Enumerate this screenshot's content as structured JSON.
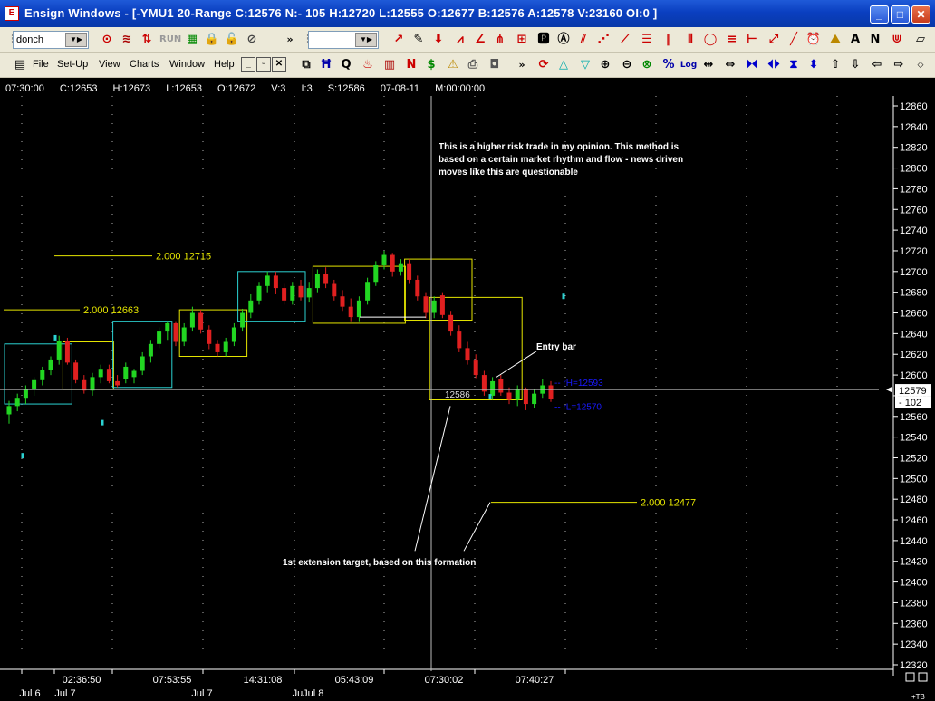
{
  "window": {
    "title": "Ensign Windows - [-YMU1 20-Range C:12576 N:- 105 H:12720 L:12555 O:12677 B:12576 A:12578 V:23160 OI:0 ]",
    "minimize": "_",
    "maximize": "□",
    "close": "✕"
  },
  "toolbar1": {
    "study_combo": "donch",
    "run_label": "RUN"
  },
  "menu": {
    "items": [
      "File",
      "Set-Up",
      "View",
      "Charts",
      "Window",
      "Help"
    ],
    "mdi_minimize": "_",
    "mdi_restore": "▫",
    "mdi_close": "✕"
  },
  "info": {
    "time": "07:30:00",
    "close": "C:12653",
    "high": "H:12673",
    "low": "L:12653",
    "open": "O:12672",
    "volume": "V:3",
    "i": "I:3",
    "s": "S:12586",
    "date": "07-08-11",
    "m": "M:00:00:00"
  },
  "annotations": {
    "note": "This is a higher risk trade in my opinion. This method is\nbased on a certain market rhythm and flow - news driven\nmoves like this are questionable",
    "entry_bar": "Entry bar",
    "first_target": "1st extension target, based on this formation"
  },
  "chart_data": {
    "type": "candlestick",
    "symbol": "-YMU1 20-Range",
    "ylim": [
      12310,
      12870
    ],
    "y_ticks": [
      12860,
      12840,
      12820,
      12800,
      12780,
      12760,
      12740,
      12720,
      12700,
      12680,
      12660,
      12640,
      12620,
      12600,
      12580,
      12560,
      12540,
      12520,
      12500,
      12480,
      12460,
      12440,
      12420,
      12400,
      12380,
      12360,
      12340,
      12320
    ],
    "x_time_labels": [
      "02:36:50",
      "07:53:55",
      "14:31:08",
      "05:43:09",
      "07:30:02",
      "07:40:27"
    ],
    "x_date_labels": [
      "Jul 6",
      "Jul 7",
      "Jul 7",
      "JuJul 8"
    ],
    "last_price": "12579",
    "net_change": "- 102",
    "corner_label": "+TB",
    "cursor_price_label": "12586",
    "cursor_price": 12586,
    "horizontal_line_price": 12586,
    "band_lines": [
      {
        "label": "rH=12593",
        "value": 12593,
        "color": "#1a1aff"
      },
      {
        "label": "rL=12570",
        "value": 12570,
        "color": "#1a1aff"
      }
    ],
    "extension_levels": [
      {
        "label": "2.000  12715",
        "value": 12715
      },
      {
        "label": "2.000  12663",
        "value": 12663
      },
      {
        "label": "2.000  12477",
        "value": 12477
      }
    ],
    "candles": [
      {
        "o": 12562,
        "h": 12575,
        "l": 12553,
        "c": 12570
      },
      {
        "o": 12570,
        "h": 12582,
        "l": 12565,
        "c": 12578
      },
      {
        "o": 12578,
        "h": 12590,
        "l": 12572,
        "c": 12586
      },
      {
        "o": 12586,
        "h": 12598,
        "l": 12580,
        "c": 12595
      },
      {
        "o": 12595,
        "h": 12608,
        "l": 12590,
        "c": 12605
      },
      {
        "o": 12605,
        "h": 12618,
        "l": 12600,
        "c": 12615
      },
      {
        "o": 12615,
        "h": 12638,
        "l": 12610,
        "c": 12633
      },
      {
        "o": 12633,
        "h": 12636,
        "l": 12610,
        "c": 12612
      },
      {
        "o": 12612,
        "h": 12615,
        "l": 12592,
        "c": 12595
      },
      {
        "o": 12595,
        "h": 12600,
        "l": 12582,
        "c": 12585
      },
      {
        "o": 12585,
        "h": 12602,
        "l": 12580,
        "c": 12598
      },
      {
        "o": 12598,
        "h": 12610,
        "l": 12592,
        "c": 12606
      },
      {
        "o": 12606,
        "h": 12610,
        "l": 12592,
        "c": 12594
      },
      {
        "o": 12594,
        "h": 12600,
        "l": 12588,
        "c": 12590
      },
      {
        "o": 12596,
        "h": 12612,
        "l": 12592,
        "c": 12608
      },
      {
        "o": 12598,
        "h": 12606,
        "l": 12592,
        "c": 12604
      },
      {
        "o": 12604,
        "h": 12622,
        "l": 12600,
        "c": 12618
      },
      {
        "o": 12618,
        "h": 12634,
        "l": 12612,
        "c": 12630
      },
      {
        "o": 12630,
        "h": 12646,
        "l": 12626,
        "c": 12642
      },
      {
        "o": 12642,
        "h": 12652,
        "l": 12634,
        "c": 12650
      },
      {
        "o": 12650,
        "h": 12652,
        "l": 12628,
        "c": 12632
      },
      {
        "o": 12632,
        "h": 12650,
        "l": 12628,
        "c": 12646
      },
      {
        "o": 12646,
        "h": 12666,
        "l": 12642,
        "c": 12660
      },
      {
        "o": 12660,
        "h": 12663,
        "l": 12640,
        "c": 12644
      },
      {
        "o": 12644,
        "h": 12648,
        "l": 12625,
        "c": 12630
      },
      {
        "o": 12630,
        "h": 12634,
        "l": 12618,
        "c": 12622
      },
      {
        "o": 12622,
        "h": 12636,
        "l": 12618,
        "c": 12632
      },
      {
        "o": 12632,
        "h": 12650,
        "l": 12628,
        "c": 12646
      },
      {
        "o": 12646,
        "h": 12664,
        "l": 12642,
        "c": 12660
      },
      {
        "o": 12660,
        "h": 12678,
        "l": 12655,
        "c": 12672
      },
      {
        "o": 12672,
        "h": 12690,
        "l": 12668,
        "c": 12686
      },
      {
        "o": 12686,
        "h": 12700,
        "l": 12680,
        "c": 12696
      },
      {
        "o": 12696,
        "h": 12700,
        "l": 12678,
        "c": 12684
      },
      {
        "o": 12684,
        "h": 12688,
        "l": 12668,
        "c": 12672
      },
      {
        "o": 12672,
        "h": 12690,
        "l": 12668,
        "c": 12686
      },
      {
        "o": 12686,
        "h": 12692,
        "l": 12672,
        "c": 12675
      },
      {
        "o": 12675,
        "h": 12690,
        "l": 12670,
        "c": 12684
      },
      {
        "o": 12684,
        "h": 12702,
        "l": 12680,
        "c": 12698
      },
      {
        "o": 12698,
        "h": 12704,
        "l": 12684,
        "c": 12688
      },
      {
        "o": 12688,
        "h": 12692,
        "l": 12672,
        "c": 12676
      },
      {
        "o": 12676,
        "h": 12682,
        "l": 12662,
        "c": 12666
      },
      {
        "o": 12666,
        "h": 12674,
        "l": 12652,
        "c": 12656
      },
      {
        "o": 12656,
        "h": 12676,
        "l": 12652,
        "c": 12672
      },
      {
        "o": 12672,
        "h": 12694,
        "l": 12668,
        "c": 12690
      },
      {
        "o": 12690,
        "h": 12710,
        "l": 12686,
        "c": 12706
      },
      {
        "o": 12706,
        "h": 12720,
        "l": 12702,
        "c": 12716
      },
      {
        "o": 12716,
        "h": 12718,
        "l": 12695,
        "c": 12700
      },
      {
        "o": 12700,
        "h": 12712,
        "l": 12696,
        "c": 12708
      },
      {
        "o": 12708,
        "h": 12712,
        "l": 12688,
        "c": 12692
      },
      {
        "o": 12692,
        "h": 12696,
        "l": 12672,
        "c": 12676
      },
      {
        "o": 12676,
        "h": 12680,
        "l": 12655,
        "c": 12660
      },
      {
        "o": 12660,
        "h": 12676,
        "l": 12655,
        "c": 12672
      },
      {
        "o": 12677,
        "h": 12680,
        "l": 12655,
        "c": 12658
      },
      {
        "o": 12658,
        "h": 12662,
        "l": 12638,
        "c": 12642
      },
      {
        "o": 12642,
        "h": 12648,
        "l": 12622,
        "c": 12626
      },
      {
        "o": 12626,
        "h": 12632,
        "l": 12610,
        "c": 12614
      },
      {
        "o": 12614,
        "h": 12620,
        "l": 12597,
        "c": 12600
      },
      {
        "o": 12600,
        "h": 12604,
        "l": 12580,
        "c": 12584
      },
      {
        "o": 12580,
        "h": 12598,
        "l": 12576,
        "c": 12594
      },
      {
        "o": 12596,
        "h": 12600,
        "l": 12580,
        "c": 12583
      },
      {
        "o": 12583,
        "h": 12588,
        "l": 12572,
        "c": 12576
      },
      {
        "o": 12576,
        "h": 12590,
        "l": 12570,
        "c": 12586
      },
      {
        "o": 12586,
        "h": 12588,
        "l": 12566,
        "c": 12572
      },
      {
        "o": 12572,
        "h": 12586,
        "l": 12568,
        "c": 12582
      },
      {
        "o": 12582,
        "h": 12596,
        "l": 12578,
        "c": 12590
      },
      {
        "o": 12590,
        "h": 12594,
        "l": 12574,
        "c": 12577
      }
    ],
    "boxes": [
      {
        "from": 0,
        "to": 7,
        "top": 12630,
        "bottom": 12572,
        "color": "#2bd2d2"
      },
      {
        "from": 7,
        "to": 12,
        "top": 12632,
        "bottom": 12586,
        "color": "#e6e600"
      },
      {
        "from": 13,
        "to": 19,
        "top": 12652,
        "bottom": 12588,
        "color": "#2bd2d2"
      },
      {
        "from": 21,
        "to": 28,
        "top": 12663,
        "bottom": 12618,
        "color": "#e6e600"
      },
      {
        "from": 28,
        "to": 35,
        "top": 12700,
        "bottom": 12652,
        "color": "#2bd2d2"
      },
      {
        "from": 37,
        "to": 47,
        "top": 12705,
        "bottom": 12650,
        "color": "#e6e600"
      },
      {
        "from": 48,
        "to": 55,
        "top": 12712,
        "bottom": 12653,
        "color": "#e6e600"
      },
      {
        "from": 51,
        "to": 61,
        "top": 12675,
        "bottom": 12576,
        "color": "#e6e600"
      }
    ]
  }
}
